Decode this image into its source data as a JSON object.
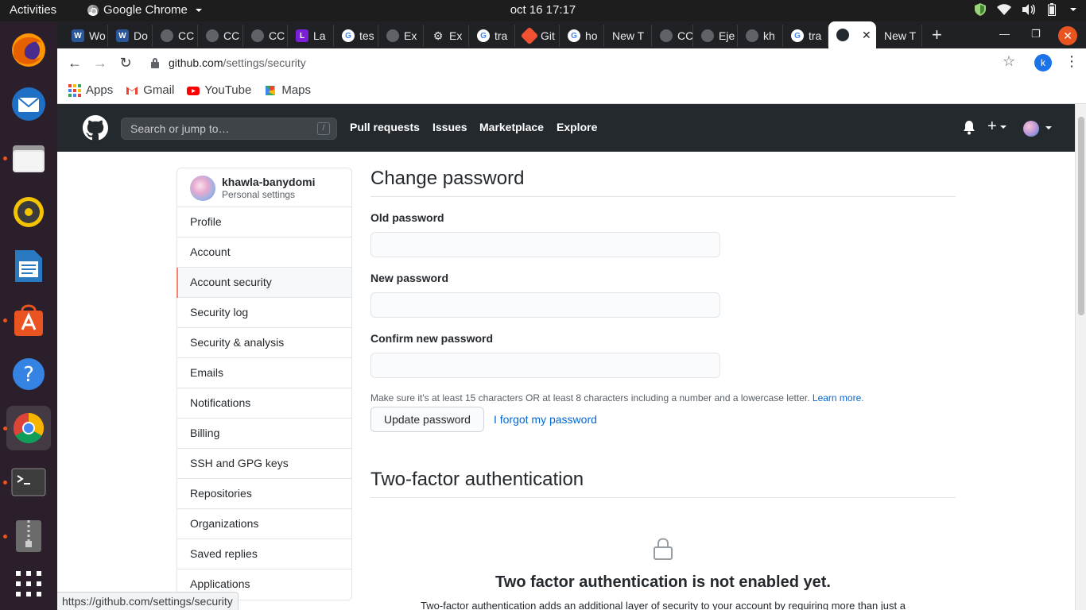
{
  "system": {
    "activities": "Activities",
    "app_name": "Google Chrome",
    "clock": "oct 16  17:17"
  },
  "dock": {
    "items": [
      {
        "name": "Firefox",
        "color": "#e66000"
      },
      {
        "name": "Thunderbird",
        "color": "#1f6fc5"
      },
      {
        "name": "Files",
        "color": "#8a8a8a"
      },
      {
        "name": "Rhythmbox",
        "color": "#f5c400"
      },
      {
        "name": "LibreOffice Writer",
        "color": "#2a7ac2"
      },
      {
        "name": "Ubuntu Software",
        "color": "#e95420"
      },
      {
        "name": "Help",
        "color": "#3584e4"
      },
      {
        "name": "Google Chrome",
        "color": "#4285f4"
      },
      {
        "name": "Terminal",
        "color": "#3c3c3c"
      },
      {
        "name": "Archive Manager",
        "color": "#6b6b6b"
      },
      {
        "name": "Show Applications",
        "color": "#2b1f2b"
      }
    ]
  },
  "tabs": [
    {
      "label": "Wo",
      "icon": "word-icon",
      "color": "#2b579a"
    },
    {
      "label": "Do",
      "icon": "word-icon",
      "color": "#2b579a"
    },
    {
      "label": "CC",
      "icon": "github-icon",
      "color": "#24292e"
    },
    {
      "label": "CC",
      "icon": "github-icon",
      "color": "#24292e"
    },
    {
      "label": "CC",
      "icon": "github-icon",
      "color": "#24292e"
    },
    {
      "label": "La",
      "icon": "laravel-icon",
      "color": "#7c1fd8"
    },
    {
      "label": "tes",
      "icon": "google-icon",
      "color": "#ffffff"
    },
    {
      "label": "Ex",
      "icon": "github-icon",
      "color": "#24292e"
    },
    {
      "label": "Ex",
      "icon": "gear-icon",
      "color": "#5f6368"
    },
    {
      "label": "tra",
      "icon": "google-icon",
      "color": "#ffffff"
    },
    {
      "label": "Git",
      "icon": "git-icon",
      "color": "#f05133"
    },
    {
      "label": "ho",
      "icon": "google-icon",
      "color": "#ffffff"
    },
    {
      "label": "New T",
      "icon": "none",
      "color": "#202124"
    },
    {
      "label": "CC",
      "icon": "github-icon",
      "color": "#24292e"
    },
    {
      "label": "Eje",
      "icon": "github-icon",
      "color": "#24292e"
    },
    {
      "label": "kh",
      "icon": "github-icon",
      "color": "#24292e"
    },
    {
      "label": "tra",
      "icon": "google-icon",
      "color": "#ffffff"
    },
    {
      "label": "",
      "icon": "github-icon",
      "color": "#24292e",
      "active": true
    },
    {
      "label": "New T",
      "icon": "none",
      "color": "#202124"
    }
  ],
  "omnibox": {
    "host": "github.com",
    "path": "/settings/security"
  },
  "profile_initial": "k",
  "bookmarks": [
    {
      "label": "Apps",
      "icon": "apps-grid-icon"
    },
    {
      "label": "Gmail",
      "icon": "gmail-icon"
    },
    {
      "label": "YouTube",
      "icon": "youtube-icon"
    },
    {
      "label": "Maps",
      "icon": "maps-icon"
    }
  ],
  "github": {
    "search_placeholder": "Search or jump to…",
    "search_shortcut": "/",
    "nav": [
      "Pull requests",
      "Issues",
      "Marketplace",
      "Explore"
    ]
  },
  "sidebar": {
    "username": "khawla-banydomi",
    "subtitle": "Personal settings",
    "items": [
      {
        "label": "Profile"
      },
      {
        "label": "Account"
      },
      {
        "label": "Account security",
        "selected": true
      },
      {
        "label": "Security log"
      },
      {
        "label": "Security & analysis"
      },
      {
        "label": "Emails"
      },
      {
        "label": "Notifications"
      },
      {
        "label": "Billing"
      },
      {
        "label": "SSH and GPG keys"
      },
      {
        "label": "Repositories"
      },
      {
        "label": "Organizations"
      },
      {
        "label": "Saved replies"
      },
      {
        "label": "Applications"
      }
    ]
  },
  "change_password": {
    "title": "Change password",
    "old_label": "Old password",
    "new_label": "New password",
    "confirm_label": "Confirm new password",
    "hint": "Make sure it's at least 15 characters OR at least 8 characters including a number and a lowercase letter.",
    "learn_more": "Learn more",
    "update_button": "Update password",
    "forgot_link": "I forgot my password"
  },
  "two_factor": {
    "title": "Two-factor authentication",
    "heading": "Two factor authentication is not enabled yet.",
    "description": "Two-factor authentication adds an additional layer of security to your account by requiring more than just a"
  },
  "status_url": "https://github.com/settings/security",
  "colors": {
    "github_header": "#24292e",
    "link": "#0366d6",
    "selected_marker": "#f9826c",
    "ubuntu_orange": "#e95420"
  }
}
